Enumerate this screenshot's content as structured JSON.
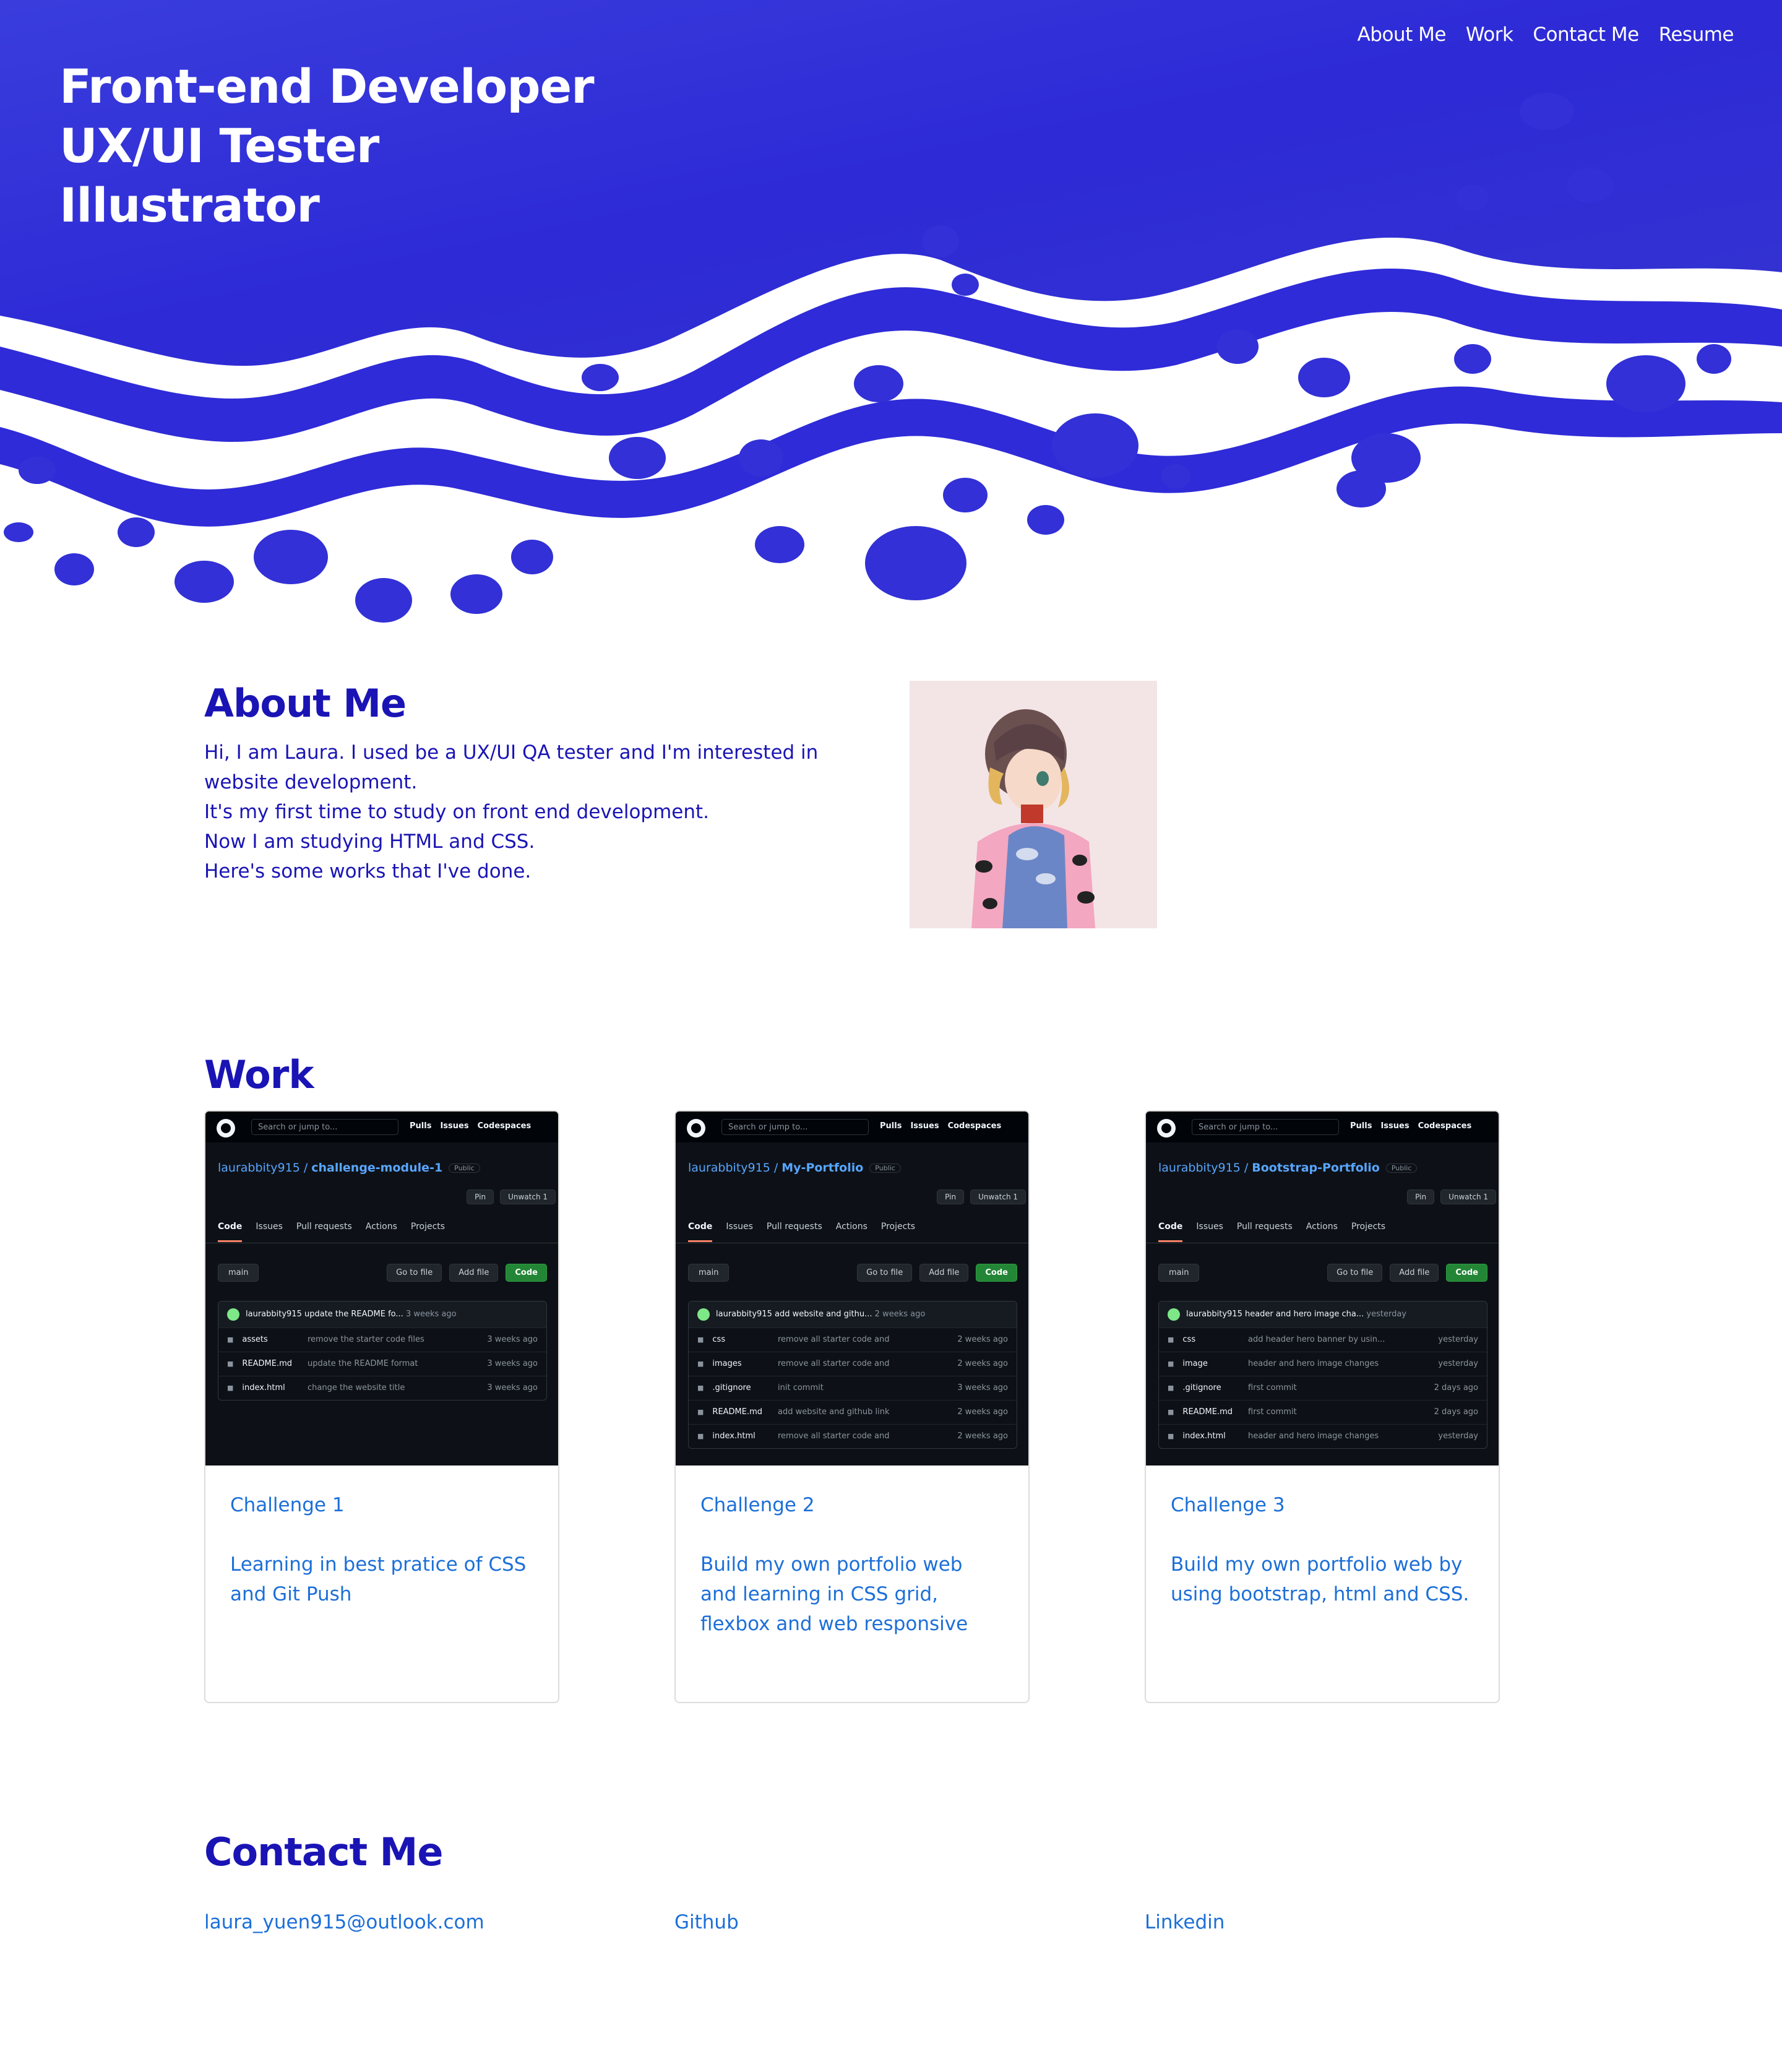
{
  "nav": {
    "items": [
      "About Me",
      "Work",
      "Contact Me",
      "Resume"
    ]
  },
  "hero": {
    "lines": [
      "Front-end Developer",
      "UX/UI Tester",
      "Illustrator"
    ]
  },
  "about": {
    "title": "About Me",
    "paragraphs": [
      "Hi, I am Laura. I used be a UX/UI QA tester and I'm interested in website development.",
      "It's my first time to study on front end development.",
      "Now I am studying HTML and CSS.",
      "Here's some works that I've done."
    ]
  },
  "work": {
    "title": "Work",
    "cards": [
      {
        "title": "Challenge 1",
        "description": "Learning in best pratice of CSS and Git Push",
        "shot": {
          "search": "Search or jump to...",
          "owner": "laurabbity915",
          "repo": "challenge-module-1",
          "visibility": "Public",
          "commit": "laurabbity915 update the README fo...",
          "commit_time": "3 weeks ago",
          "files": [
            {
              "name": "assets",
              "msg": "remove the starter code files",
              "date": "3 weeks ago"
            },
            {
              "name": "README.md",
              "msg": "update the README format",
              "date": "3 weeks ago"
            },
            {
              "name": "index.html",
              "msg": "change the website title",
              "date": "3 weeks ago"
            }
          ],
          "readme": "README.md"
        }
      },
      {
        "title": "Challenge 2",
        "description": "Build my own portfolio web and learning in CSS grid, flexbox and web responsive",
        "shot": {
          "search": "Search or jump to...",
          "owner": "laurabbity915",
          "repo": "My-Portfolio",
          "visibility": "Public",
          "commit": "laurabbity915 add website and githu...",
          "commit_time": "2 weeks ago",
          "files": [
            {
              "name": "css",
              "msg": "remove all starter code and",
              "date": "2 weeks ago"
            },
            {
              "name": "images",
              "msg": "remove all starter code and",
              "date": "2 weeks ago"
            },
            {
              "name": ".gitignore",
              "msg": "init commit",
              "date": "3 weeks ago"
            },
            {
              "name": "README.md",
              "msg": "add website and github link",
              "date": "2 weeks ago"
            },
            {
              "name": "index.html",
              "msg": "remove all starter code and",
              "date": "2 weeks ago"
            }
          ],
          "readme": ""
        }
      },
      {
        "title": "Challenge 3",
        "description": "Build my own portfolio web by using bootstrap, html and CSS.",
        "shot": {
          "search": "Search or jump to...",
          "owner": "laurabbity915",
          "repo": "Bootstrap-Portfolio",
          "visibility": "Public",
          "commit": "laurabbity915 header and hero image cha...",
          "commit_time": "yesterday",
          "files": [
            {
              "name": "css",
              "msg": "add header hero banner by usin...",
              "date": "yesterday"
            },
            {
              "name": "image",
              "msg": "header and hero image changes",
              "date": "yesterday"
            },
            {
              "name": ".gitignore",
              "msg": "first commit",
              "date": "2 days ago"
            },
            {
              "name": "README.md",
              "msg": "first commit",
              "date": "2 days ago"
            },
            {
              "name": "index.html",
              "msg": "header and hero image changes",
              "date": "yesterday"
            }
          ],
          "readme": ""
        }
      }
    ],
    "shot_ui": {
      "top_links": [
        "Pulls",
        "Issues",
        "Codespaces"
      ],
      "buttons": [
        "Pin",
        "Unwatch 1"
      ],
      "tabs": [
        "Code",
        "Issues",
        "Pull requests",
        "Actions",
        "Projects"
      ],
      "branch": "main",
      "actions": [
        "Go to file",
        "Add file",
        "Code"
      ]
    }
  },
  "contact": {
    "title": "Contact Me",
    "email": "laura_yuen915@outlook.com",
    "github": "Github",
    "linkedin": "Linkedin"
  },
  "colors": {
    "brand_blue": "#1a14b5",
    "hero_blue": "#2f2bd8",
    "link_blue": "#1c6fd8"
  }
}
